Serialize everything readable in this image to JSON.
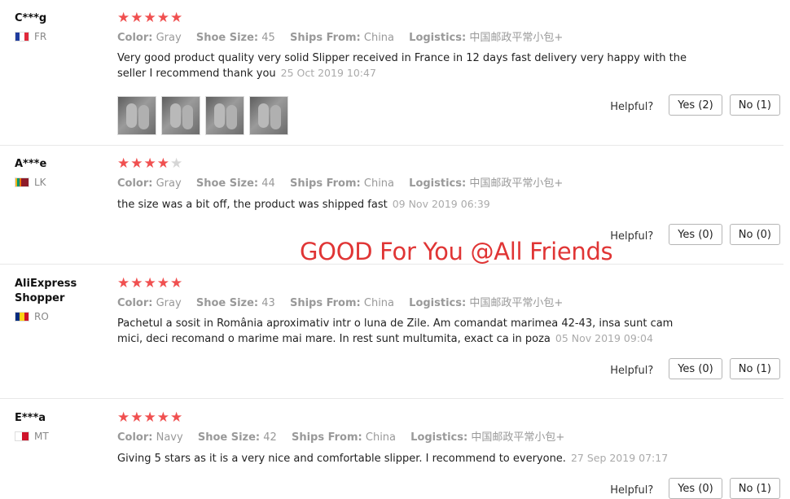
{
  "helpful_label": "Helpful?",
  "watermark": "GOOD For You @All Friends",
  "attr_labels": {
    "color": "Color:",
    "size": "Shoe Size:",
    "ships": "Ships From:",
    "logistics": "Logistics:"
  },
  "colors": {
    "star": "#f05050",
    "star_empty": "#d6d6d6",
    "watermark": "#e03535"
  },
  "reviews": [
    {
      "user": "C***g",
      "country": "FR",
      "rating": 5,
      "color": "Gray",
      "size": "45",
      "ships_from": "China",
      "logistics": "中国邮政平常小包+",
      "text": "Very good product quality very solid Slipper received in France in 12 days fast delivery very happy with the seller I recommend thank you",
      "date": "25 Oct 2019 10:47",
      "photos": [
        "slipper-photo-1",
        "slipper-photo-2",
        "slipper-photo-3",
        "slipper-photo-4"
      ],
      "yes": "Yes (2)",
      "no": "No (1)"
    },
    {
      "user": "A***e",
      "country": "LK",
      "rating": 4,
      "color": "Gray",
      "size": "44",
      "ships_from": "China",
      "logistics": "中国邮政平常小包+",
      "text": "the size was a bit off, the product was shipped fast",
      "date": "09 Nov 2019 06:39",
      "yes": "Yes (0)",
      "no": "No (0)"
    },
    {
      "user": "AliExpress Shopper",
      "country": "RO",
      "rating": 5,
      "color": "Gray",
      "size": "43",
      "ships_from": "China",
      "logistics": "中国邮政平常小包+",
      "text": "Pachetul a sosit in România aproximativ intr o luna de Zile. Am comandat marimea 42-43, insa sunt cam mici, deci recomand o marime mai mare. In rest sunt multumita, exact ca in poza",
      "date": "05 Nov 2019 09:04",
      "yes": "Yes (0)",
      "no": "No (1)"
    },
    {
      "user": "E***a",
      "country": "MT",
      "rating": 5,
      "color": "Navy",
      "size": "42",
      "ships_from": "China",
      "logistics": "中国邮政平常小包+",
      "text": "Giving 5 stars as it is a very nice and comfortable slipper. I recommend to everyone.",
      "date": "27 Sep 2019 07:17",
      "yes": "Yes (0)",
      "no": "No (1)"
    }
  ]
}
